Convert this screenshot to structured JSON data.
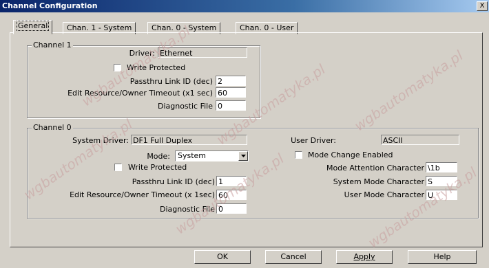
{
  "window": {
    "title": "Channel Configuration",
    "close_glyph": "X"
  },
  "tabs": [
    {
      "label": "General"
    },
    {
      "label": "Chan. 1 - System"
    },
    {
      "label": "Chan. 0 - System"
    },
    {
      "label": "Chan. 0 - User"
    }
  ],
  "channel1": {
    "legend": "Channel 1",
    "driver_label": "Driver:",
    "driver_value": "Ethernet",
    "write_protected_label": "Write Protected",
    "passthru_label": "Passthru Link ID (dec)",
    "passthru_value": "2",
    "timeout_label": "Edit Resource/Owner Timeout (x1 sec)",
    "timeout_value": "60",
    "diag_label": "Diagnostic File",
    "diag_value": "0"
  },
  "channel0": {
    "legend": "Channel 0",
    "system_driver_label": "System Driver:",
    "system_driver_value": "DF1 Full Duplex",
    "user_driver_label": "User Driver:",
    "user_driver_value": "ASCII",
    "mode_label": "Mode:",
    "mode_value": "System",
    "mode_change_label": "Mode Change Enabled",
    "write_protected_label": "Write Protected",
    "mode_attention_label": "Mode Attention Character",
    "mode_attention_value": "\\1b",
    "passthru_label": "Passthru Link ID (dec)",
    "passthru_value": "1",
    "system_mode_char_label": "System Mode Character",
    "system_mode_char_value": "S",
    "timeout_label": "Edit Resource/Owner Timeout (x 1sec)",
    "timeout_value": "60",
    "user_mode_char_label": "User Mode Character",
    "user_mode_char_value": "U",
    "diag_label": "Diagnostic File",
    "diag_value": "0"
  },
  "buttons": {
    "ok": "OK",
    "cancel": "Cancel",
    "apply": "Apply",
    "help": "Help"
  },
  "watermark": "wgbautomatyka.pl"
}
